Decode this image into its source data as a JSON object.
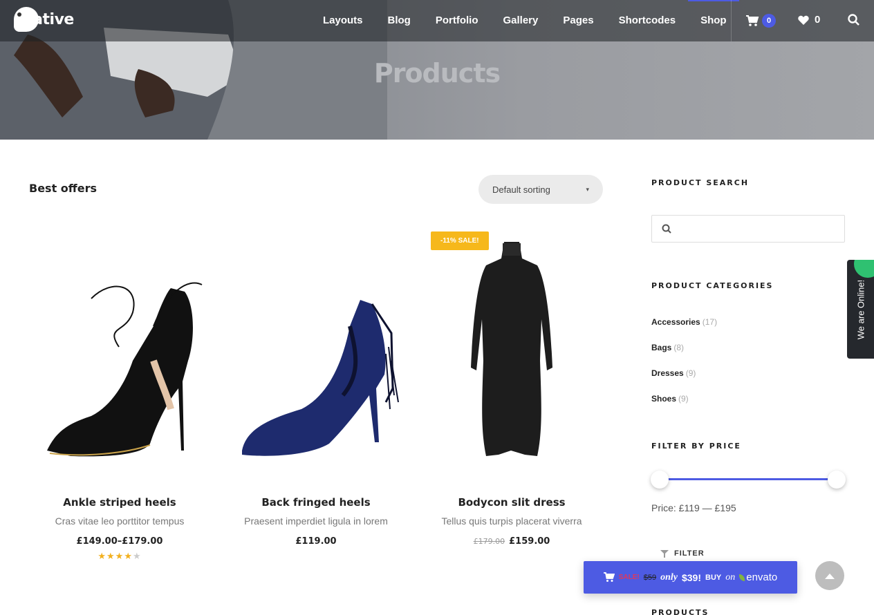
{
  "hero": {
    "title": "Products"
  },
  "nav": {
    "logo": {
      "text_prefix": "",
      "text": "native"
    },
    "items": [
      {
        "label": "Layouts"
      },
      {
        "label": "Blog"
      },
      {
        "label": "Portfolio"
      },
      {
        "label": "Gallery"
      },
      {
        "label": "Pages"
      },
      {
        "label": "Shortcodes"
      },
      {
        "label": "Shop"
      }
    ],
    "active": "Shop",
    "cart_count": "0",
    "wishlist_count": "0"
  },
  "main": {
    "section_title": "Best offers",
    "sort": {
      "selected": "Default sorting"
    },
    "products": [
      {
        "name": "Ankle striped heels",
        "desc": "Cras vitae leo porttitor tempus",
        "price": "£149.00–£179.00",
        "old_price": "",
        "rating": 4,
        "rating_max": 5
      },
      {
        "name": "Back fringed heels",
        "desc": "Praesent imperdiet ligula in lorem",
        "price": "£119.00",
        "old_price": ""
      },
      {
        "name": "Bodycon slit dress",
        "desc": "Tellus quis turpis placerat viverra",
        "price": "£159.00",
        "old_price": "£179.00",
        "badge": "-11% SALE!"
      }
    ]
  },
  "sidebar": {
    "search_heading": "PRODUCT SEARCH",
    "categories_heading": "PRODUCT CATEGORIES",
    "categories": [
      {
        "name": "Accessories",
        "count": "(17)"
      },
      {
        "name": "Bags",
        "count": "(8)"
      },
      {
        "name": "Dresses",
        "count": "(9)"
      },
      {
        "name": "Shoes",
        "count": "(9)"
      }
    ],
    "price_heading": "FILTER BY PRICE",
    "price_text": "Price: £119 — £195",
    "filter_label": "FILTER",
    "products_heading": "PRODUCTS"
  },
  "widgets": {
    "online": "We are Online!",
    "buy": {
      "sale": "SALE!",
      "was": "$59",
      "only": "only",
      "amount": "$39!",
      "buy": "BUY",
      "on": "on",
      "brand": "envato"
    }
  },
  "colors": {
    "accent": "#4d5be3",
    "sale": "#f6b81b",
    "online_dot": "#2fc171"
  }
}
